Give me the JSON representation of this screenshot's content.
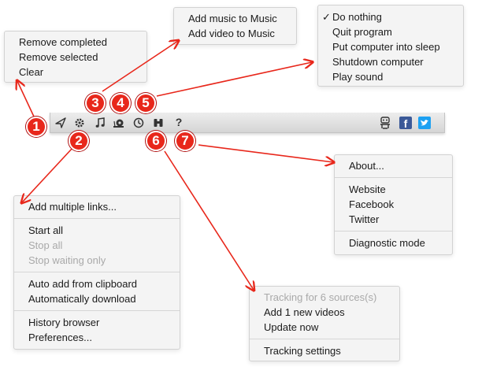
{
  "menus": {
    "remove": {
      "items": [
        "Remove completed",
        "Remove selected",
        "Clear"
      ]
    },
    "music": {
      "items": [
        "Add music to Music",
        "Add video to Music"
      ]
    },
    "finish": {
      "checkmark": "✓",
      "items": [
        "Do nothing",
        "Quit program",
        "Put computer into sleep",
        "Shutdown computer",
        "Play sound"
      ]
    },
    "main": {
      "add_multiple": "Add multiple links...",
      "start_all": "Start all",
      "stop_all": "Stop all",
      "stop_waiting": "Stop waiting only",
      "auto_clipboard": "Auto add from clipboard",
      "auto_download": "Automatically download",
      "history": "History browser",
      "preferences": "Preferences..."
    },
    "help": {
      "about": "About...",
      "website": "Website",
      "facebook": "Facebook",
      "twitter": "Twitter",
      "diagnostic": "Diagnostic mode"
    },
    "tracking": {
      "status": "Tracking for 6 sources(s)",
      "add_new": "Add 1 new videos",
      "update": "Update now",
      "settings": "Tracking settings"
    }
  },
  "toolbar": {
    "icons": [
      "clean-icon",
      "gear-icon",
      "music-note-icon",
      "snail-icon",
      "clock-icon",
      "binoculars-icon",
      "help-icon",
      "robot-icon",
      "facebook-icon",
      "twitter-icon"
    ],
    "help_glyph": "?",
    "facebook_glyph": "f"
  },
  "badges": [
    "1",
    "2",
    "3",
    "4",
    "5",
    "6",
    "7"
  ],
  "colors": {
    "badge": "#e8271b",
    "arrow": "#e8271b",
    "facebook": "#3b5998",
    "twitter": "#1da1f2"
  }
}
